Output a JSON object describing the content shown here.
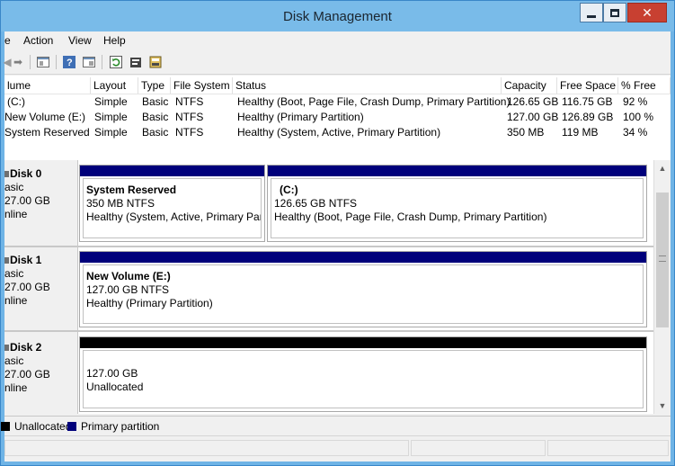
{
  "window": {
    "title": "Disk Management"
  },
  "menu": [
    "e",
    "Action",
    "View",
    "Help"
  ],
  "toolbar_icons": [
    "back-arrow-icon",
    "forward-arrow-icon",
    "console-tree-icon",
    "help-icon",
    "properties-panel-icon",
    "refresh-icon",
    "properties-icon",
    "export-icon"
  ],
  "volume_table": {
    "headers": [
      "lume",
      "Layout",
      "Type",
      "File System",
      "Status",
      "Capacity",
      "Free Space",
      "% Free"
    ],
    "rows": [
      [
        "(C:)",
        "Simple",
        "Basic",
        "NTFS",
        "Healthy (Boot, Page File, Crash Dump, Primary Partition)",
        "126.65 GB",
        "116.75 GB",
        "92 %"
      ],
      [
        "New Volume (E:)",
        "Simple",
        "Basic",
        "NTFS",
        "Healthy (Primary Partition)",
        "127.00 GB",
        "126.89 GB",
        "100 %"
      ],
      [
        "System Reserved",
        "Simple",
        "Basic",
        "NTFS",
        "Healthy (System, Active, Primary Partition)",
        "350 MB",
        "119 MB",
        "34 %"
      ]
    ]
  },
  "disks": [
    {
      "name": "Disk 0",
      "type": "asic",
      "size": "27.00 GB",
      "status": "nline"
    },
    {
      "name": "Disk 1",
      "type": "asic",
      "size": "27.00 GB",
      "status": "nline"
    },
    {
      "name": "Disk 2",
      "type": "asic",
      "size": "27.00 GB",
      "status": "nline"
    }
  ],
  "partitions": {
    "system_reserved": {
      "title": "System Reserved",
      "size": "350 MB NTFS",
      "status": "Healthy (System, Active, Primary Partiti"
    },
    "c_drive": {
      "title": "(C:)",
      "size": "126.65 GB NTFS",
      "status": "Healthy (Boot, Page File, Crash Dump, Primary Partition)"
    },
    "e_drive": {
      "title": "New Volume  (E:)",
      "size": "127.00 GB NTFS",
      "status": "Healthy (Primary Partition)"
    },
    "unallocated": {
      "size": "127.00 GB",
      "status": "Unallocated"
    }
  },
  "legend": {
    "unallocated": "Unallocated",
    "primary": "Primary partition"
  },
  "colors": {
    "primary": "#00007b",
    "unallocated": "#000000",
    "title_bar": "#79bbe9",
    "close_button": "#c84031"
  }
}
